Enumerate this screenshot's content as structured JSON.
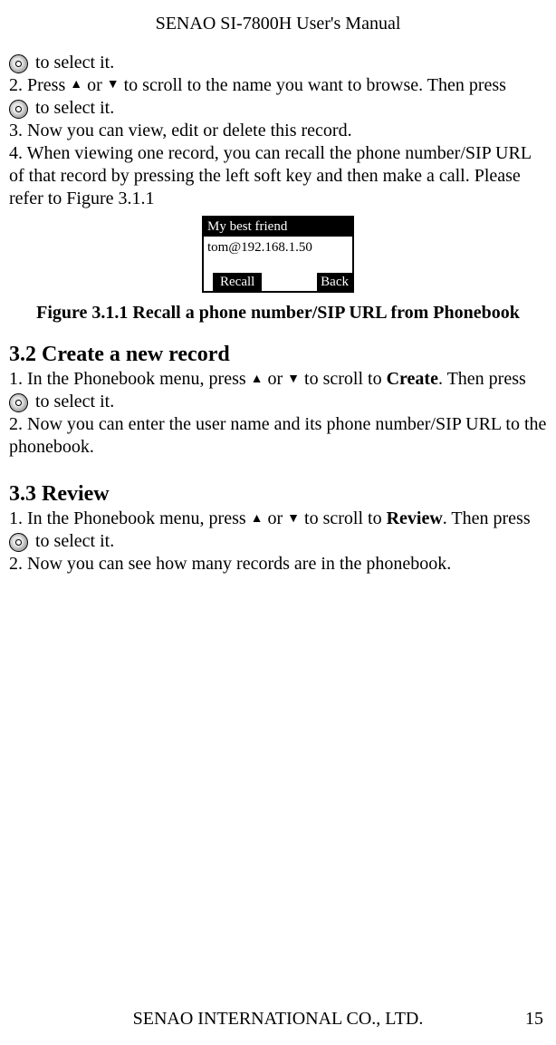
{
  "header": {
    "title": "SENAO SI-7800H User's Manual"
  },
  "body": {
    "line1_tail": " to select it.",
    "step2_a": "2. Press ",
    "or": " or ",
    "step2_b": " to scroll to the name you want to browse. Then press",
    "step2_tail": " to select it.",
    "step3": "3. Now you can view, edit or delete this record.",
    "step4": "4. When viewing one record, you can recall the phone number/SIP URL of that record by pressing the left soft key and then make a call. Please refer to Figure 3.1.1",
    "figure": {
      "row1": "My best friend",
      "row2": "tom@192.168.1.50",
      "recall": "Recall",
      "back": "Back"
    },
    "figure_caption": "Figure 3.1.1 Recall a phone number/SIP URL from Phonebook",
    "sec32_title": "3.2 Create a new record",
    "sec32_step1_a": "1. In the Phonebook menu, press ",
    "sec32_step1_b": " to scroll to ",
    "create_word": "Create",
    "then_press": ". Then press",
    "to_select_pad": "   to select it.",
    "sec32_step2": "2. Now you can enter the user name and its phone number/SIP URL to the phonebook.",
    "sec33_title": "3.3 Review",
    "sec33_step1_a": "1. In the Phonebook menu, press ",
    "sec33_step1_b": " to scroll to ",
    "review_word": "Review",
    "sec33_step2": "2. Now you can see how many records are in the phonebook."
  },
  "footer": {
    "company": "SENAO INTERNATIONAL CO., LTD.",
    "page": "15"
  },
  "icons": {
    "up": "▲",
    "down": "▼"
  }
}
